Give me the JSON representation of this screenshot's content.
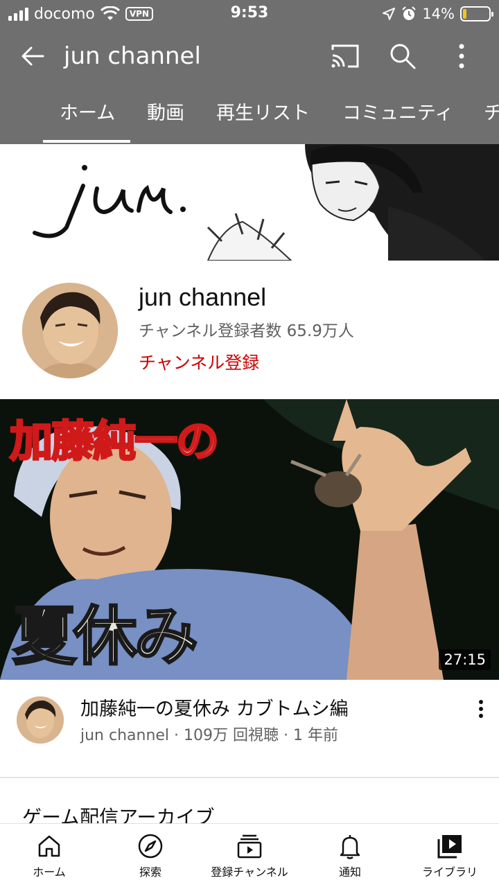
{
  "status_bar": {
    "carrier": "docomo",
    "vpn": "VPN",
    "time": "9:53",
    "battery": "14%",
    "battery_level": 0.14
  },
  "header": {
    "title": "jun channel",
    "icons": [
      "back-arrow-icon",
      "cast-icon",
      "search-icon",
      "more-vert-icon"
    ]
  },
  "tabs": [
    {
      "label": "ホーム",
      "selected": true
    },
    {
      "label": "動画"
    },
    {
      "label": "再生リスト"
    },
    {
      "label": "コミュニティ"
    },
    {
      "label": "チ"
    }
  ],
  "banner": {
    "logo_text": "jun."
  },
  "channel": {
    "name": "jun channel",
    "subscribers": "チャンネル登録者数 65.9万人",
    "subscribe_label": "チャンネル登録"
  },
  "video": {
    "thumb_text_top": "加藤純一の",
    "thumb_text_bottom": "夏休み",
    "duration": "27:15",
    "title": "加藤純一の夏休み カブトムシ編",
    "meta": "jun channel · 109万 回視聴 · 1 年前"
  },
  "section": {
    "title": "ゲーム配信アーカイブ"
  },
  "bottom_nav": [
    {
      "label": "ホーム",
      "icon": "home-icon"
    },
    {
      "label": "探索",
      "icon": "explore-icon"
    },
    {
      "label": "登録チャンネル",
      "icon": "subscriptions-icon"
    },
    {
      "label": "通知",
      "icon": "bell-icon"
    },
    {
      "label": "ライブラリ",
      "icon": "library-icon"
    }
  ],
  "colors": {
    "header_bg": "#6f6f6f",
    "subscribe": "#cc0000",
    "battery": "#f5c518"
  }
}
